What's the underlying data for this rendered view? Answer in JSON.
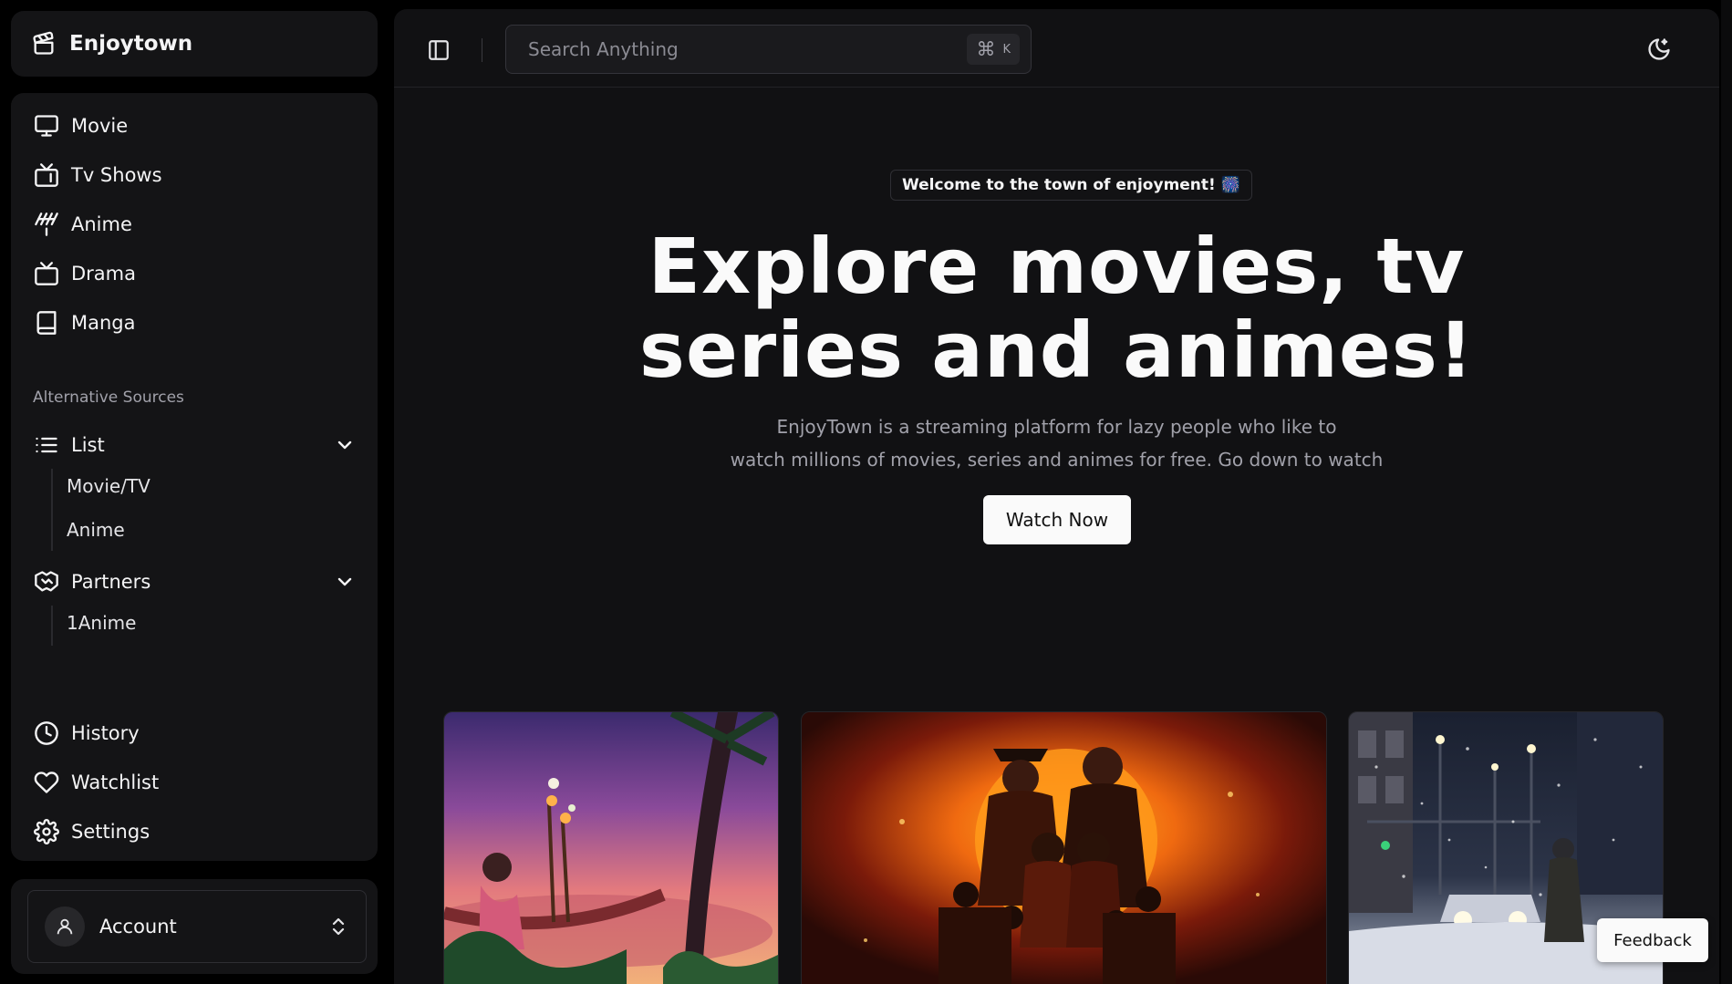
{
  "brand": {
    "name": "Enjoytown",
    "icon": "clapperboard-icon"
  },
  "nav": {
    "main_items": [
      {
        "label": "Movie",
        "icon": "monitor-icon"
      },
      {
        "label": "Tv Shows",
        "icon": "tv-retro-icon"
      },
      {
        "label": "Anime",
        "icon": "antenna-icon"
      },
      {
        "label": "Drama",
        "icon": "tv-icon"
      },
      {
        "label": "Manga",
        "icon": "book-icon"
      }
    ],
    "section_label": "Alternative Sources",
    "list_group": {
      "label": "List",
      "icon": "list-icon",
      "children": [
        "Movie/TV",
        "Anime"
      ]
    },
    "partners_group": {
      "label": "Partners",
      "icon": "handshake-icon",
      "children": [
        "1Anime"
      ]
    },
    "bottom_items": [
      {
        "label": "History",
        "icon": "clock-icon"
      },
      {
        "label": "Watchlist",
        "icon": "heart-icon"
      },
      {
        "label": "Settings",
        "icon": "settings-icon"
      }
    ]
  },
  "account": {
    "label": "Account",
    "icon": "user-icon"
  },
  "topbar": {
    "search_placeholder": "Search Anything",
    "shortcut_symbol": "⌘",
    "shortcut_key": "K"
  },
  "hero": {
    "badge": "Welcome to the town of enjoyment! 🎆",
    "title_line1": "Explore movies, tv",
    "title_line2": "series and animes!",
    "description_line1": "EnjoyTown is a streaming platform for lazy people who like to",
    "description_line2": "watch millions of movies, series and animes for free. Go down to watch",
    "cta_label": "Watch Now"
  },
  "feedback_label": "Feedback",
  "colors": {
    "background": "#000000",
    "panel": "#141416",
    "main": "#111113",
    "text": "#f4f4f5",
    "muted": "#a1a1aa",
    "button": "#fafafa"
  }
}
